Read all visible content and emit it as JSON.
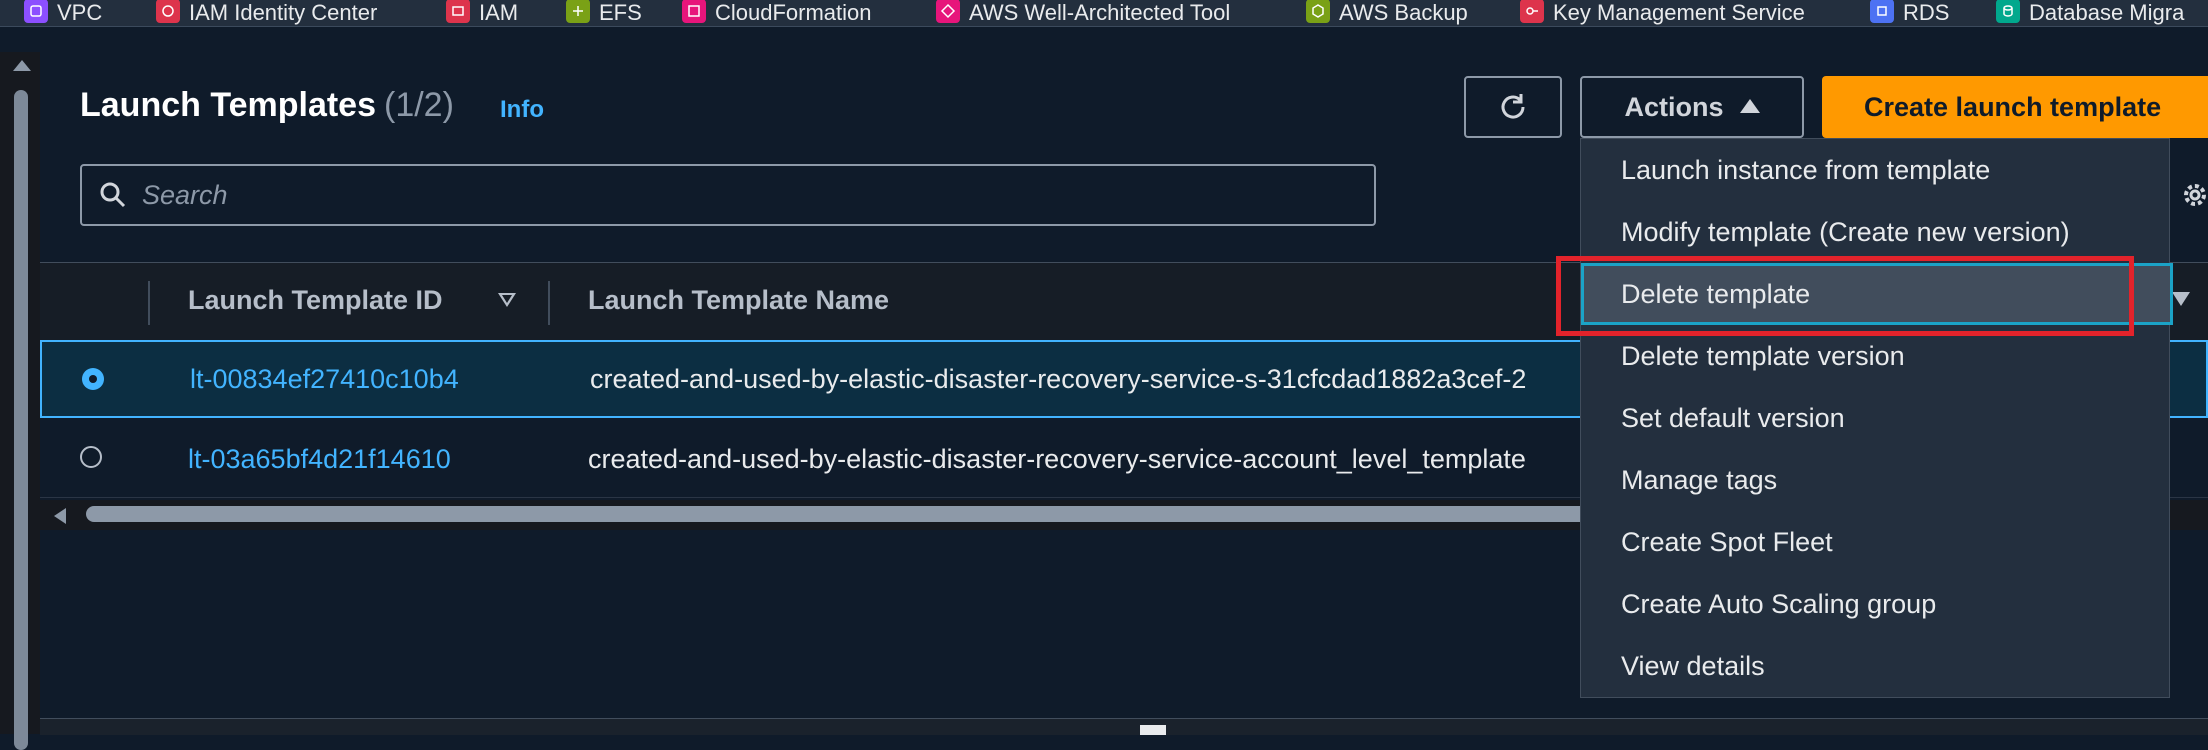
{
  "favorites": [
    {
      "label": "VPC",
      "icon": "vpc-icon",
      "color": "#8c4fff"
    },
    {
      "label": "IAM Identity Center",
      "icon": "identity-center-icon",
      "color": "#dd344c"
    },
    {
      "label": "IAM",
      "icon": "iam-icon",
      "color": "#dd344c"
    },
    {
      "label": "EFS",
      "icon": "efs-icon",
      "color": "#7aa116"
    },
    {
      "label": "CloudFormation",
      "icon": "cloudformation-icon",
      "color": "#e7157b"
    },
    {
      "label": "AWS Well-Architected Tool",
      "icon": "well-architected-icon",
      "color": "#e7157b"
    },
    {
      "label": "AWS Backup",
      "icon": "backup-icon",
      "color": "#7aa116"
    },
    {
      "label": "Key Management Service",
      "icon": "kms-icon",
      "color": "#dd344c"
    },
    {
      "label": "RDS",
      "icon": "rds-icon",
      "color": "#4d72f3"
    },
    {
      "label": "Database Migra",
      "icon": "dms-icon",
      "color": "#01a88d"
    }
  ],
  "header": {
    "title": "Launch Templates",
    "count": "(1/2)",
    "info": "Info",
    "actions_label": "Actions",
    "create_label": "Create launch template"
  },
  "search": {
    "placeholder": "Search"
  },
  "table": {
    "columns": [
      "Launch Template ID",
      "Launch Template Name"
    ],
    "rows": [
      {
        "id": "lt-00834ef27410c10b4",
        "name": "created-and-used-by-elastic-disaster-recovery-service-s-31cfcdad1882a3cef-2",
        "selected": true
      },
      {
        "id": "lt-03a65bf4d21f14610",
        "name": "created-and-used-by-elastic-disaster-recovery-service-account_level_template",
        "selected": false
      }
    ]
  },
  "actions_menu": [
    "Launch instance from template",
    "Modify template (Create new version)",
    "Delete template",
    "Delete template version",
    "Set default version",
    "Manage tags",
    "Create Spot Fleet",
    "Create Auto Scaling group",
    "View details"
  ],
  "highlighted_menu_item": "Delete template",
  "colors": {
    "accent": "#42b4ff",
    "primary_button": "#ff9900",
    "highlight_outline": "#e3232b"
  }
}
